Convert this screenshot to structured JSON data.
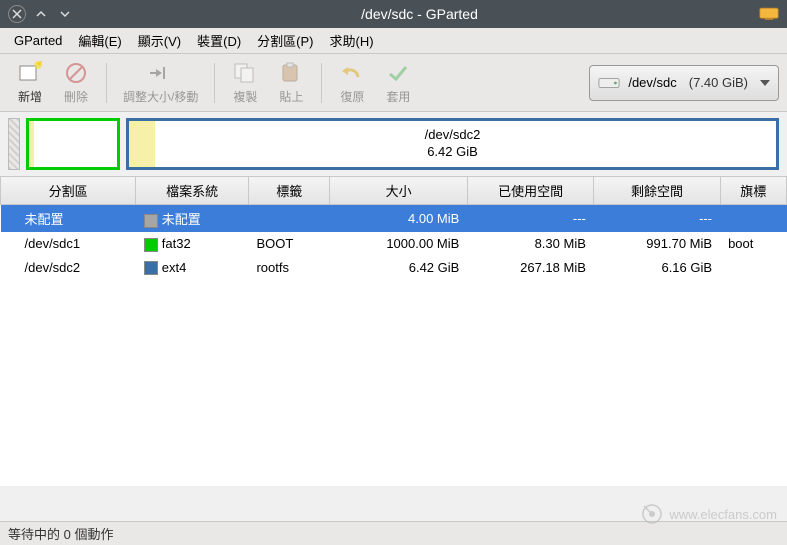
{
  "window": {
    "title": "/dev/sdc - GParted"
  },
  "menu": {
    "gparted": "GParted",
    "edit": "編輯(E)",
    "view": "顯示(V)",
    "device": "裝置(D)",
    "partition": "分割區(P)",
    "help": "求助(H)"
  },
  "toolbar": {
    "new": "新增",
    "delete": "刪除",
    "resize": "調整大小/移動",
    "copy": "複製",
    "paste": "貼上",
    "undo": "復原",
    "apply": "套用"
  },
  "device_selector": {
    "path": "/dev/sdc",
    "size": "(7.40 GiB)"
  },
  "partmap": {
    "big_label_line1": "/dev/sdc2",
    "big_label_line2": "6.42 GiB"
  },
  "columns": {
    "partition": "分割區",
    "filesystem": "檔案系統",
    "label": "標籤",
    "size": "大小",
    "used": "已使用空間",
    "unused": "剩餘空間",
    "flags": "旗標"
  },
  "rows": [
    {
      "partition": "未配置",
      "fs_color": "#a6a6a6",
      "fs_name": "未配置",
      "label": "",
      "size": "4.00 MiB",
      "used": "---",
      "unused": "---",
      "flags": "",
      "selected": true
    },
    {
      "partition": "/dev/sdc1",
      "fs_color": "#00cc00",
      "fs_name": "fat32",
      "label": "BOOT",
      "size": "1000.00 MiB",
      "used": "8.30 MiB",
      "unused": "991.70 MiB",
      "flags": "boot",
      "selected": false
    },
    {
      "partition": "/dev/sdc2",
      "fs_color": "#3b6ea5",
      "fs_name": "ext4",
      "label": "rootfs",
      "size": "6.42 GiB",
      "used": "267.18 MiB",
      "unused": "6.16 GiB",
      "flags": "",
      "selected": false
    }
  ],
  "status": "等待中的 0 個動作",
  "watermark": "www.elecfans.com"
}
